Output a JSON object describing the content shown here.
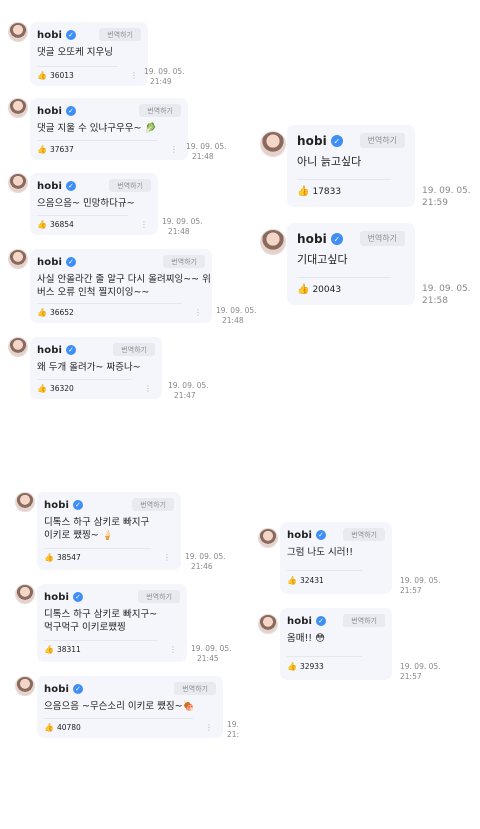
{
  "translate_label": "번역하기",
  "verified_glyph": "✓",
  "like_glyph": "👍",
  "more_glyph": "⋮",
  "posts": [
    {
      "name": "hobi",
      "text": "댓글 오또케 지우닝",
      "likes": "36013",
      "date": "19. 09. 05.",
      "time": "21:49"
    },
    {
      "name": "hobi",
      "text": "댓글 지울 수 있냐구우우~ 🥬",
      "likes": "37637",
      "date": "19. 09. 05.",
      "time": "21:48"
    },
    {
      "name": "hobi",
      "text": "으음으음~ 민망하다규~",
      "likes": "36854",
      "date": "19. 09. 05.",
      "time": "21:48"
    },
    {
      "name": "hobi",
      "text": "사실 안올라간 줄 알구 다시 올려찌잉~~ 위\n버스 오류 인척 찔지이잉~~",
      "likes": "36652",
      "date": "19. 09. 05.",
      "time": "21:48"
    },
    {
      "name": "hobi",
      "text": "왜 두개 올려가~ 짜증나~",
      "likes": "36320",
      "date": "19. 09. 05.",
      "time": "21:47"
    },
    {
      "name": "hobi",
      "text": "아니 늙고싶다",
      "likes": "17833",
      "date": "19. 09. 05.",
      "time": "21:59"
    },
    {
      "name": "hobi",
      "text": "기대고싶다",
      "likes": "20043",
      "date": "19. 09. 05.",
      "time": "21:58"
    },
    {
      "name": "hobi",
      "text": "디톡스 하구 삼키로 빠지구\n이키로 쨌찡~ 🍦",
      "likes": "38547",
      "date": "19. 09. 05.",
      "time": "21:46"
    },
    {
      "name": "hobi",
      "text": "디톡스 하구 삼키로 빠지구~\n먹구먹구 이키로쨌찡",
      "likes": "38311",
      "date": "19. 09. 05.",
      "time": "21:45"
    },
    {
      "name": "hobi",
      "text": "으음으음 ~무슨소리 이키로 쨌징~🍖",
      "likes": "40780",
      "date": "19.",
      "time": "21:"
    },
    {
      "name": "hobi",
      "text": "그럼 나도 시러!!",
      "likes": "32431",
      "date": "19. 09. 05.",
      "time": "21:57"
    },
    {
      "name": "hobi",
      "text": "옴매!! 😳",
      "likes": "32933",
      "date": "19. 09. 05.",
      "time": "21:57"
    }
  ]
}
